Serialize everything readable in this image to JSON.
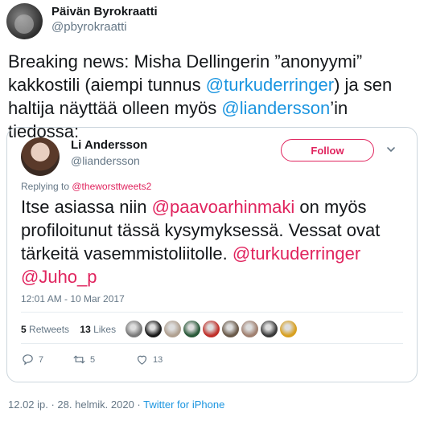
{
  "tweet": {
    "author_name": "Päivän Byrokraatti",
    "author_handle": "@pbyrokraatti",
    "text_1": "Breaking news: Misha Dellingerin ”anonyymi” kakkostili (aiempi tunnus ",
    "mention_1": "@turkuderringer",
    "text_2": ") ja sen haltija näyttää olleen myös ",
    "mention_2": "@liandersson",
    "text_3": "’in tiedossa:",
    "timestamp": "12.02 ip. · 28. helmik. 2020 · ",
    "client": "Twitter for iPhone"
  },
  "quote": {
    "author_name": "Li Andersson",
    "author_handle": "@liandersson",
    "follow_label": "Follow",
    "replying_prefix": "Replying to ",
    "replying_mention": "@theworsttweets2",
    "text_1": "Itse asiassa niin ",
    "mention_1": "@paavoarhinmaki",
    "text_2": " on myös profiloitunut tässä kysymyksessä. Vessat ovat tärkeitä vasemmistoliitolle. ",
    "mention_2": "@turkuderringer",
    "text_3": " ",
    "mention_3": "@Juho_p",
    "time": "12:01 AM - 10 Mar 2017",
    "retweets_count": "5",
    "retweets_label": " Retweets",
    "likes_count": "13",
    "likes_label": " Likes",
    "reply_count": "7",
    "retweet_action_count": "5",
    "like_action_count": "13",
    "liker_colors": [
      "#7a7a7a",
      "#1a1a1a",
      "#b0a090",
      "#2a5a3a",
      "#c0302a",
      "#6a5a4a",
      "#a08070",
      "#3a3a3a",
      "#d8a020"
    ]
  },
  "icons": [
    "chevron-down-icon",
    "reply-icon",
    "retweet-icon",
    "heart-icon"
  ]
}
